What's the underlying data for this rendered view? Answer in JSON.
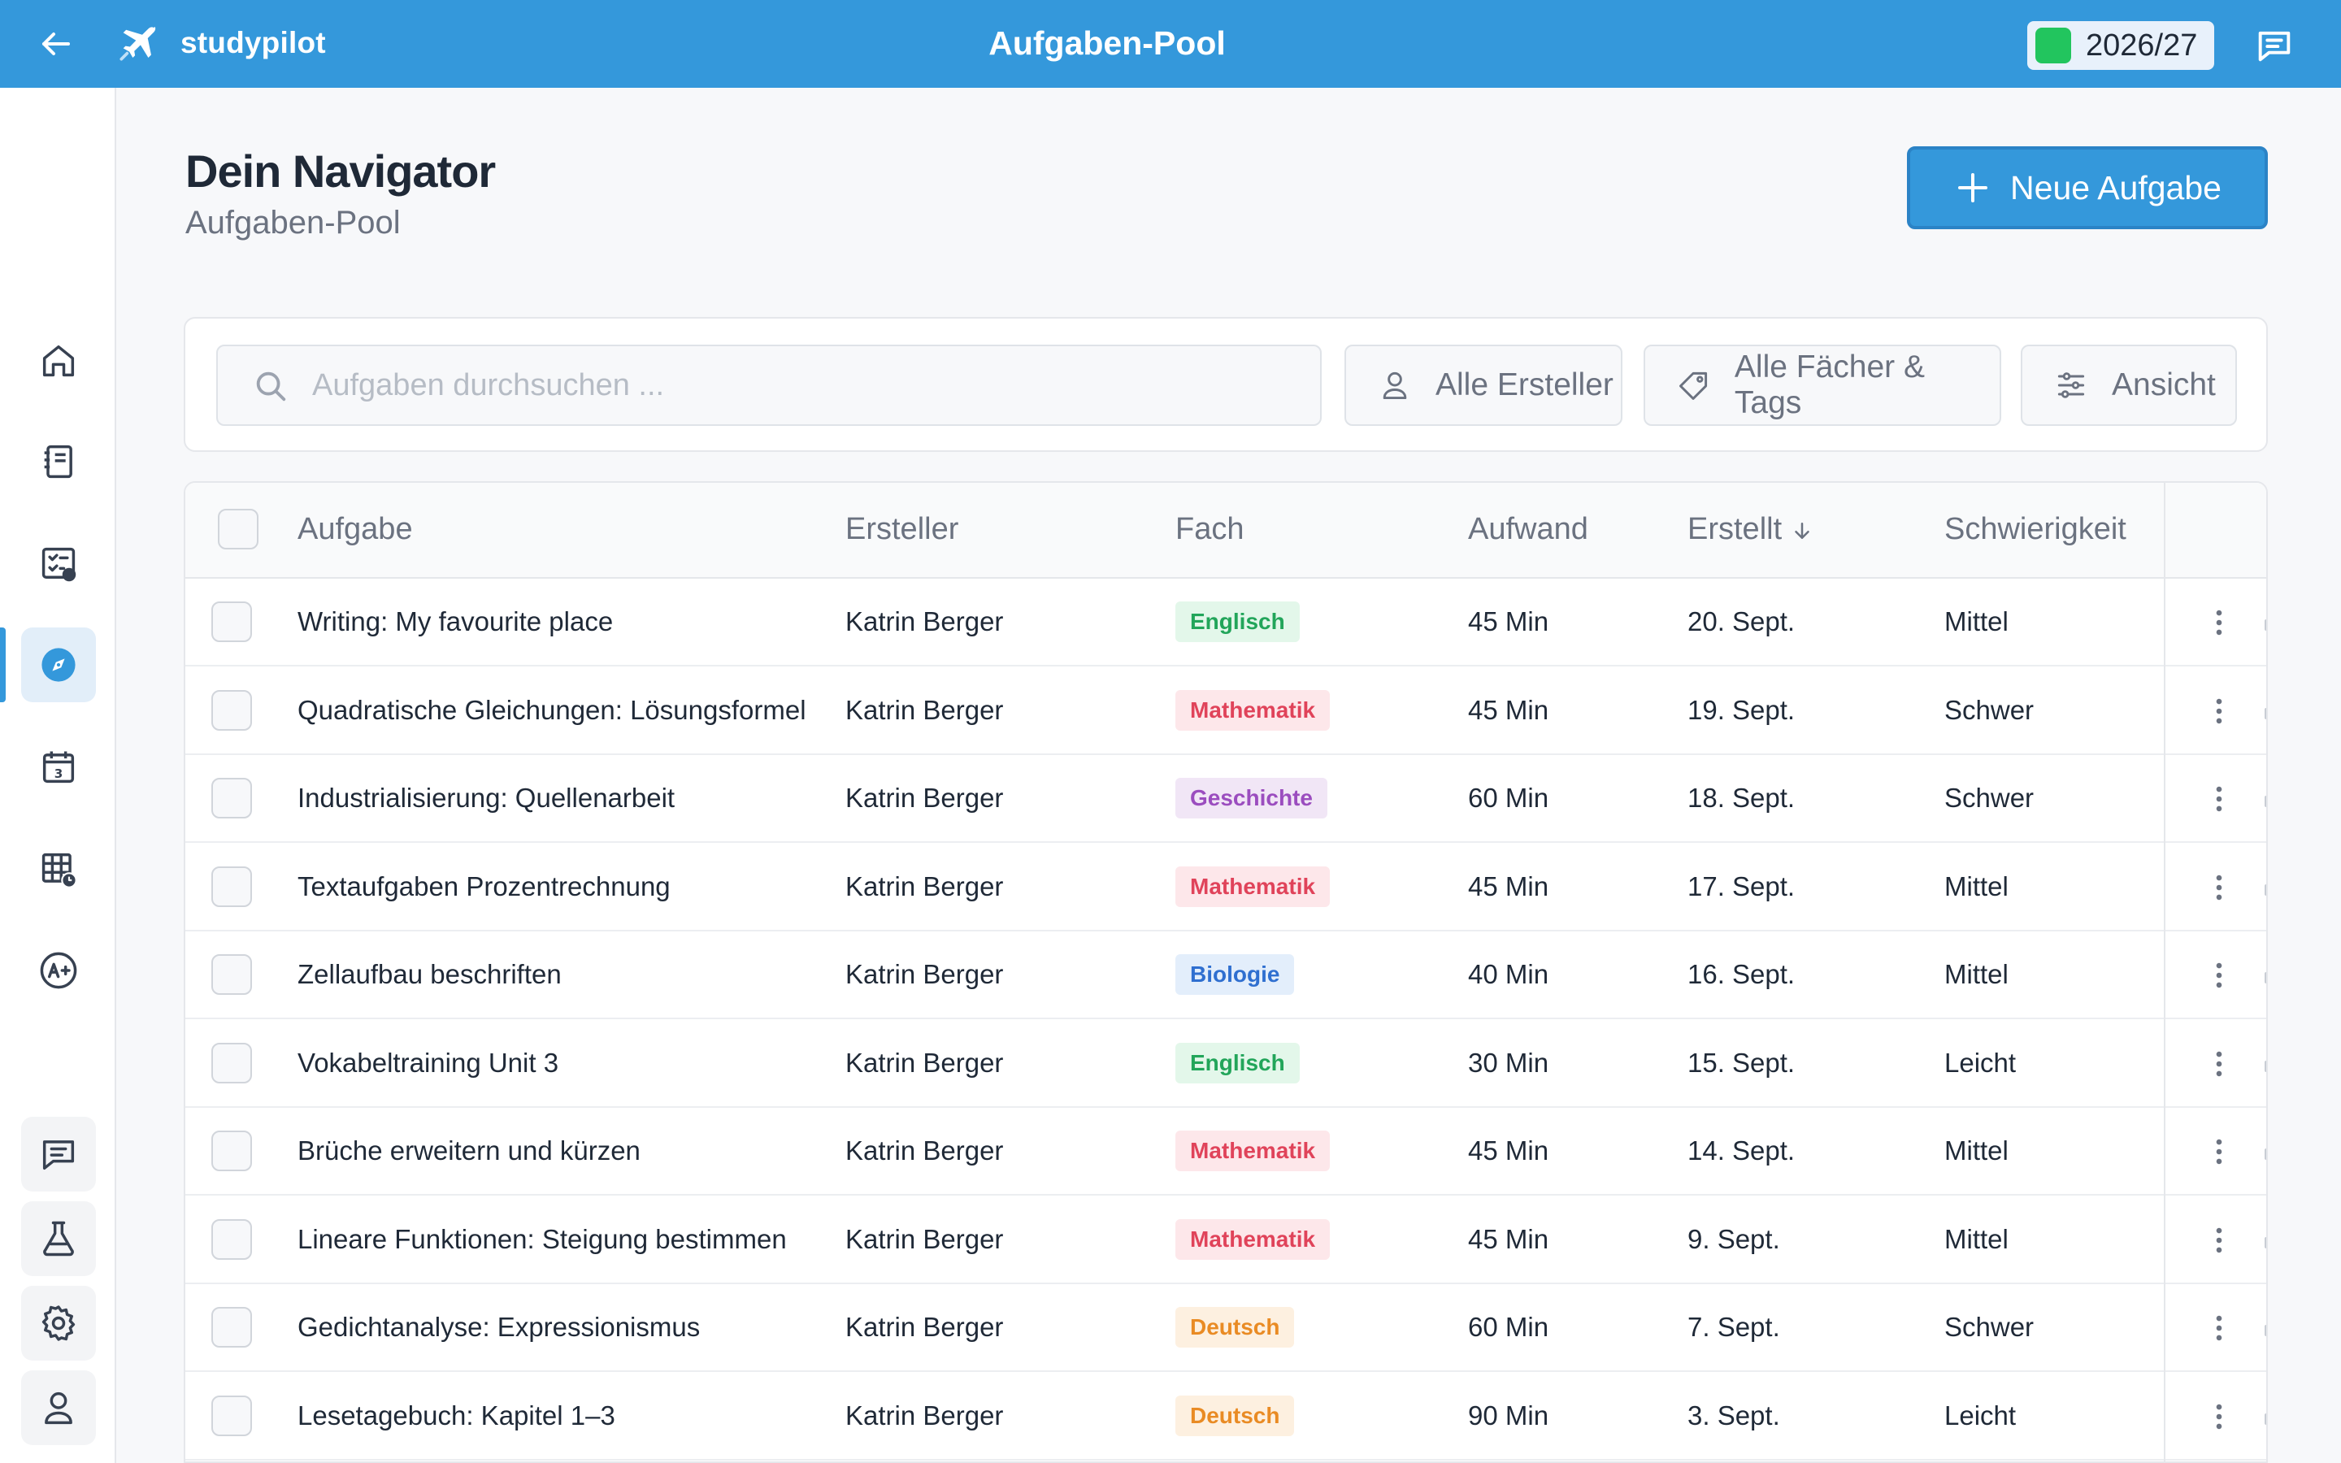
{
  "topbar": {
    "brand": "studypilot",
    "title": "Aufgaben-Pool",
    "year": "2026/27",
    "color": "#3498db"
  },
  "header": {
    "title": "Dein Navigator",
    "subtitle": "Aufgaben-Pool",
    "new_button": "Neue Aufgabe"
  },
  "filters": {
    "search_placeholder": "Aufgaben durchsuchen ...",
    "creators": "Alle Ersteller",
    "subjects": "Alle Fächer & Tags",
    "view": "Ansicht"
  },
  "table": {
    "columns": [
      "Aufgabe",
      "Ersteller",
      "Fach",
      "Aufwand",
      "Erstellt",
      "Schwierigkeit"
    ],
    "sort_column": "Erstellt",
    "sort_direction": "desc",
    "rows": [
      {
        "task": "Writing: My favourite place",
        "creator": "Katrin Berger",
        "subject": "Englisch",
        "effort": "45 Min",
        "created": "20. Sept.",
        "difficulty": "Mittel"
      },
      {
        "task": "Quadratische Gleichungen: Lösungsformel",
        "creator": "Katrin Berger",
        "subject": "Mathematik",
        "effort": "45 Min",
        "created": "19. Sept.",
        "difficulty": "Schwer"
      },
      {
        "task": "Industrialisierung: Quellenarbeit",
        "creator": "Katrin Berger",
        "subject": "Geschichte",
        "effort": "60 Min",
        "created": "18. Sept.",
        "difficulty": "Schwer"
      },
      {
        "task": "Textaufgaben Prozentrechnung",
        "creator": "Katrin Berger",
        "subject": "Mathematik",
        "effort": "45 Min",
        "created": "17. Sept.",
        "difficulty": "Mittel"
      },
      {
        "task": "Zellaufbau beschriften",
        "creator": "Katrin Berger",
        "subject": "Biologie",
        "effort": "40 Min",
        "created": "16. Sept.",
        "difficulty": "Mittel"
      },
      {
        "task": "Vokabeltraining Unit 3",
        "creator": "Katrin Berger",
        "subject": "Englisch",
        "effort": "30 Min",
        "created": "15. Sept.",
        "difficulty": "Leicht"
      },
      {
        "task": "Brüche erweitern und kürzen",
        "creator": "Katrin Berger",
        "subject": "Mathematik",
        "effort": "45 Min",
        "created": "14. Sept.",
        "difficulty": "Mittel"
      },
      {
        "task": "Lineare Funktionen: Steigung bestimmen",
        "creator": "Katrin Berger",
        "subject": "Mathematik",
        "effort": "45 Min",
        "created": "9. Sept.",
        "difficulty": "Mittel"
      },
      {
        "task": "Gedichtanalyse: Expressionismus",
        "creator": "Katrin Berger",
        "subject": "Deutsch",
        "effort": "60 Min",
        "created": "7. Sept.",
        "difficulty": "Schwer"
      },
      {
        "task": "Lesetagebuch: Kapitel 1–3",
        "creator": "Katrin Berger",
        "subject": "Deutsch",
        "effort": "90 Min",
        "created": "3. Sept.",
        "difficulty": "Leicht"
      }
    ]
  },
  "subject_colors": {
    "Englisch": {
      "bg": "#e3f7ea",
      "fg": "#22a55a"
    },
    "Mathematik": {
      "bg": "#fde7ea",
      "fg": "#e0435a"
    },
    "Geschichte": {
      "bg": "#f1e6f6",
      "fg": "#9b4dbf"
    },
    "Biologie": {
      "bg": "#e3eefb",
      "fg": "#2f6fd0"
    },
    "Deutsch": {
      "bg": "#fdf0e0",
      "fg": "#e98b24"
    }
  },
  "sidebar": {
    "items": [
      "home-icon",
      "notebook-icon",
      "tasks-icon",
      "compass-icon",
      "calendar-icon",
      "timetable-icon",
      "grades-icon",
      "chat-icon",
      "lab-icon",
      "settings-icon",
      "profile-icon"
    ],
    "active": "compass-icon"
  }
}
